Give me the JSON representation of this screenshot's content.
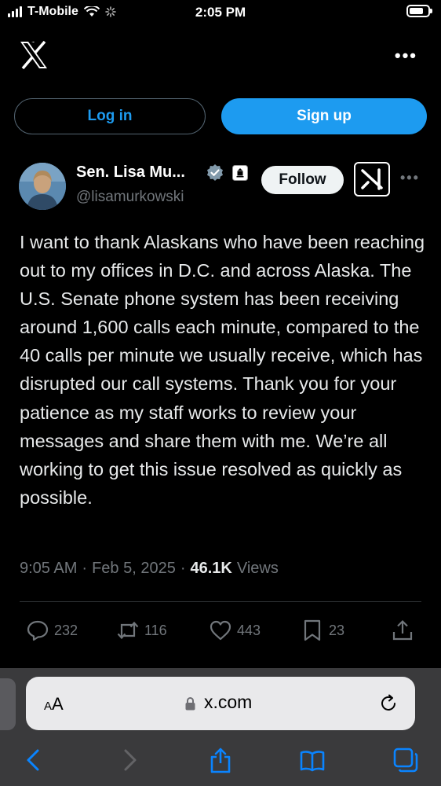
{
  "status_bar": {
    "carrier": "T-Mobile",
    "time": "2:05 PM"
  },
  "header": {
    "login_label": "Log in",
    "signup_label": "Sign up"
  },
  "author": {
    "name": "Sen. Lisa Mu...",
    "handle": "@lisamurkowski",
    "follow_label": "Follow"
  },
  "tweet": {
    "text": "I want to thank Alaskans who have been reaching out to my offices in D.C. and across Alaska. The U.S. Senate phone system has been receiving around 1,600 calls each minute, compared to the 40 calls per minute we usually receive, which has disrupted our call systems. Thank you for your patience as my staff works to review your messages and share them with me. We’re all working to get this issue resolved as quickly as possible.",
    "time": "9:05 AM",
    "date": "Feb 5, 2025",
    "views_count": "46.1K",
    "views_label": "Views",
    "separator": "·"
  },
  "actions": {
    "replies": "232",
    "reposts": "116",
    "likes": "443",
    "bookmarks": "23"
  },
  "browser": {
    "aa_label": "AA",
    "url": "x.com"
  },
  "icons": [
    "x-logo",
    "more-icon",
    "verified-icon",
    "government-badge-icon",
    "grok-icon",
    "reply-icon",
    "repost-icon",
    "like-icon",
    "bookmark-icon",
    "share-icon",
    "lock-icon",
    "reload-icon",
    "back-icon",
    "forward-icon",
    "share-sheet-icon",
    "bookmarks-book-icon",
    "tabs-icon"
  ],
  "colors": {
    "accent": "#1d9bf0",
    "verified": "#829aab",
    "text": "#e7e9ea",
    "muted": "#71767b"
  }
}
